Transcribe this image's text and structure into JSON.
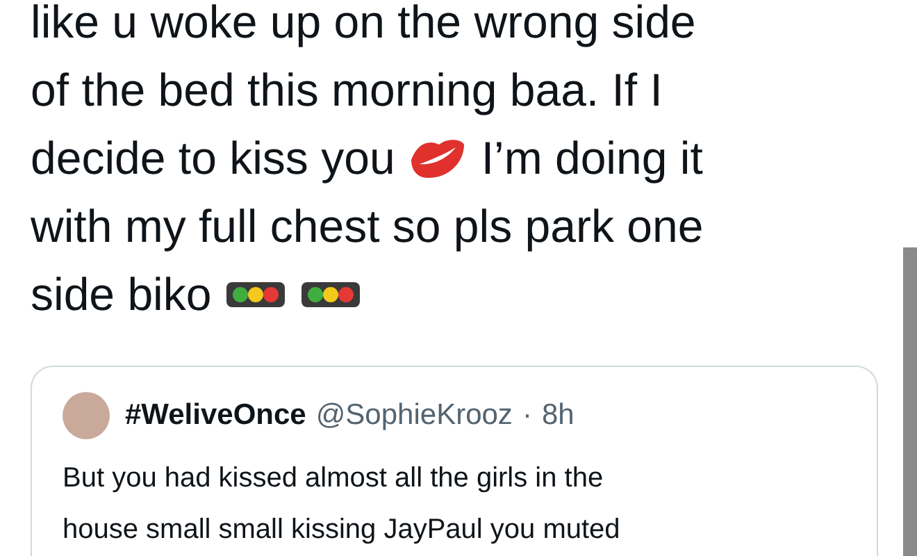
{
  "tweet": {
    "lines": [
      [
        {
          "kind": "text",
          "text": "like u woke up on the wrong side"
        }
      ],
      [
        {
          "kind": "text",
          "text": "of the bed this morning baa. If I"
        }
      ],
      [
        {
          "kind": "text",
          "text": "decide to kiss you"
        },
        {
          "kind": "kiss"
        },
        {
          "kind": "text",
          "text": "I’m doing it"
        }
      ],
      [
        {
          "kind": "text",
          "text": "with my full chest so pls park one"
        }
      ],
      [
        {
          "kind": "text",
          "text": "side biko"
        },
        {
          "kind": "traffic_light"
        },
        {
          "kind": "traffic_light"
        }
      ]
    ]
  },
  "quoted_tweet": {
    "display_name": "#WeliveOnce",
    "handle": "@SophieKrooz",
    "separator": "·",
    "time": "8h",
    "lines": [
      "But you had kissed almost all the girls in the",
      "house small small kissing JayPaul you muted"
    ]
  }
}
